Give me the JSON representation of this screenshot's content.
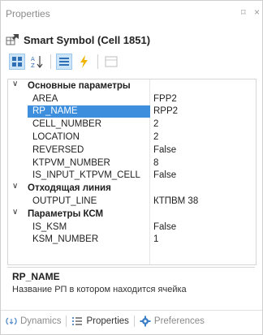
{
  "panel": {
    "title": "Properties",
    "pin_glyph": "⌑",
    "close_glyph": "×"
  },
  "object": {
    "title": "Smart Symbol (Cell 1851)",
    "icon": "smart-symbol-icon"
  },
  "toolbar": {
    "buttons": [
      {
        "name": "categorized-icon",
        "active": true
      },
      {
        "name": "alphabetical-icon",
        "active": false
      },
      {
        "name": "properties-icon",
        "active": true
      },
      {
        "name": "events-icon",
        "active": false
      },
      {
        "name": "property-pages-icon",
        "active": false
      }
    ]
  },
  "grid": {
    "categories": [
      {
        "label": "Основные параметры",
        "chevron": "∨",
        "properties": [
          {
            "name": "AREA",
            "value": "FPP2"
          },
          {
            "name": "RP_NAME",
            "value": "RPP2",
            "selected": true
          },
          {
            "name": "CELL_NUMBER",
            "value": "2"
          },
          {
            "name": "LOCATION",
            "value": "2"
          },
          {
            "name": "REVERSED",
            "value": "False"
          },
          {
            "name": "KTPVM_NUMBER",
            "value": "8"
          },
          {
            "name": "IS_INPUT_KTPVM_CELL",
            "value": "False"
          }
        ]
      },
      {
        "label": "Отходящая линия",
        "chevron": "∨",
        "properties": [
          {
            "name": "OUTPUT_LINE",
            "value": "КТПВМ 38"
          }
        ]
      },
      {
        "label": "Параметры КСМ",
        "chevron": "∨",
        "properties": [
          {
            "name": "IS_KSM",
            "value": "False"
          },
          {
            "name": "KSM_NUMBER",
            "value": "1"
          }
        ]
      }
    ]
  },
  "description": {
    "title": "RP_NAME",
    "text": "Название РП в котором находится ячейка"
  },
  "tabs": [
    {
      "label": "Dynamics",
      "icon": "dynamics-icon",
      "active": false
    },
    {
      "label": "Properties",
      "icon": "properties-list-icon",
      "active": true
    },
    {
      "label": "Preferences",
      "icon": "gear-icon",
      "active": false
    }
  ]
}
